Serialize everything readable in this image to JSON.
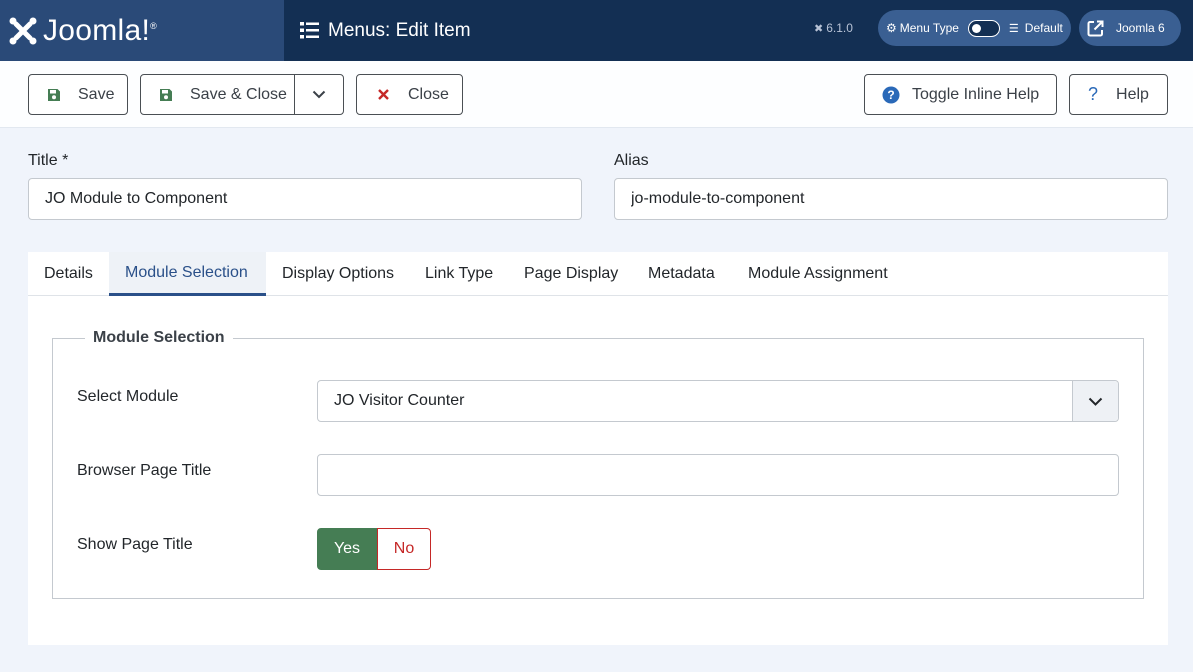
{
  "header": {
    "brand": "Joomla!",
    "page_title": "Menus: Edit Item",
    "version": "6.1.0",
    "menu_type_label": "Menu Type",
    "menu_type_value": "Default",
    "site_label": "Joomla 6"
  },
  "toolbar": {
    "save": "Save",
    "save_close": "Save & Close",
    "close": "Close",
    "toggle_inline_help": "Toggle Inline Help",
    "help": "Help"
  },
  "form": {
    "title_label": "Title *",
    "title_value": "JO Module to Component",
    "alias_label": "Alias",
    "alias_value": "jo-module-to-component"
  },
  "tabs": [
    {
      "label": "Details"
    },
    {
      "label": "Module Selection",
      "active": true
    },
    {
      "label": "Display Options"
    },
    {
      "label": "Link Type"
    },
    {
      "label": "Page Display"
    },
    {
      "label": "Metadata"
    },
    {
      "label": "Module Assignment"
    }
  ],
  "module_selection": {
    "legend": "Module Selection",
    "select_module_label": "Select Module",
    "select_module_value": "JO Visitor Counter",
    "browser_title_label": "Browser Page Title",
    "browser_title_value": "",
    "show_title_label": "Show Page Title",
    "show_title_yes": "Yes",
    "show_title_no": "No",
    "show_title_selected": "Yes"
  },
  "colors": {
    "header_bg": "#132f53",
    "logo_bg": "#2a4a78",
    "accent": "#2a5089",
    "yes_green": "#457d54",
    "no_red": "#c52827",
    "close_red": "#c52827"
  }
}
